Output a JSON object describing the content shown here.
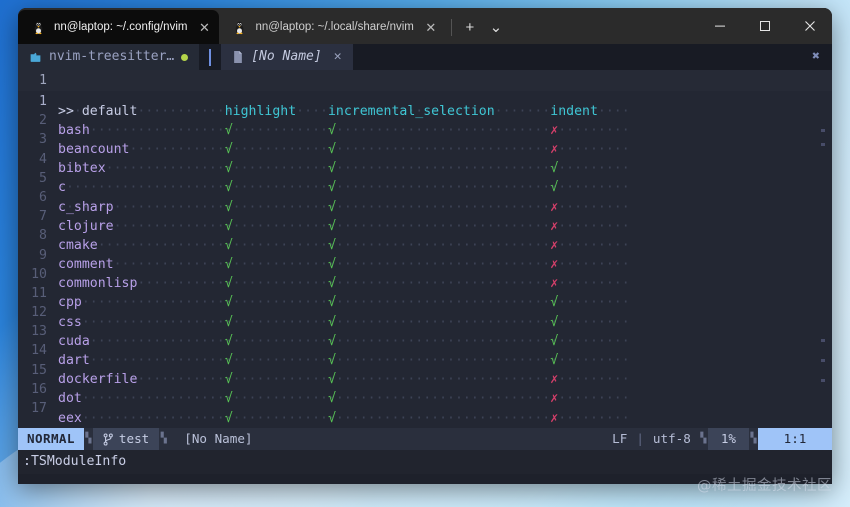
{
  "window": {
    "terminal_tabs": [
      {
        "title": "nn@laptop: ~/.config/nvim",
        "active": true,
        "close_label": "✕",
        "icon": "linux-tux-icon"
      },
      {
        "title": "nn@laptop: ~/.local/share/nvim",
        "active": false,
        "close_label": "✕",
        "icon": "linux-tux-icon"
      }
    ],
    "new_tab_label": "+",
    "tab_menu_label": "⌄",
    "controls": {
      "minimize": "–",
      "maximize": "▢",
      "close": "✕"
    }
  },
  "bufferline": {
    "directory": {
      "name": "nvim-treesitter…",
      "icon": "folder-session-icon",
      "modified_dot": true
    },
    "buffer": {
      "name": "[No Name]",
      "icon": "file-icon",
      "close_label": "✕"
    },
    "close_all_label": "✖"
  },
  "split_top": {
    "line_number": "1"
  },
  "buffer_view": {
    "header": {
      "line_number": "1",
      "marker": ">>",
      "label": "default",
      "columns": [
        "highlight",
        "incremental_selection",
        "indent"
      ]
    },
    "check_yes": "√",
    "check_no": "✗",
    "rows": [
      {
        "line_number": "2",
        "language": "bash",
        "highlight": true,
        "incremental_selection": true,
        "indent": false
      },
      {
        "line_number": "3",
        "language": "beancount",
        "highlight": true,
        "incremental_selection": true,
        "indent": false
      },
      {
        "line_number": "4",
        "language": "bibtex",
        "highlight": true,
        "incremental_selection": true,
        "indent": true
      },
      {
        "line_number": "5",
        "language": "c",
        "highlight": true,
        "incremental_selection": true,
        "indent": true
      },
      {
        "line_number": "6",
        "language": "c_sharp",
        "highlight": true,
        "incremental_selection": true,
        "indent": false
      },
      {
        "line_number": "7",
        "language": "clojure",
        "highlight": true,
        "incremental_selection": true,
        "indent": false
      },
      {
        "line_number": "8",
        "language": "cmake",
        "highlight": true,
        "incremental_selection": true,
        "indent": false
      },
      {
        "line_number": "9",
        "language": "comment",
        "highlight": true,
        "incremental_selection": true,
        "indent": false
      },
      {
        "line_number": "10",
        "language": "commonlisp",
        "highlight": true,
        "incremental_selection": true,
        "indent": false
      },
      {
        "line_number": "11",
        "language": "cpp",
        "highlight": true,
        "incremental_selection": true,
        "indent": true
      },
      {
        "line_number": "12",
        "language": "css",
        "highlight": true,
        "incremental_selection": true,
        "indent": true
      },
      {
        "line_number": "13",
        "language": "cuda",
        "highlight": true,
        "incremental_selection": true,
        "indent": true
      },
      {
        "line_number": "14",
        "language": "dart",
        "highlight": true,
        "incremental_selection": true,
        "indent": true
      },
      {
        "line_number": "15",
        "language": "dockerfile",
        "highlight": true,
        "incremental_selection": true,
        "indent": false
      },
      {
        "line_number": "16",
        "language": "dot",
        "highlight": true,
        "incremental_selection": true,
        "indent": false
      },
      {
        "line_number": "17",
        "language": "eex",
        "highlight": true,
        "incremental_selection": true,
        "indent": false
      }
    ]
  },
  "statusline": {
    "mode": "NORMAL",
    "branch": "test",
    "branch_icon": "git-branch-icon",
    "file": "[No Name]",
    "line_ending": "LF",
    "separator": "|",
    "encoding": "utf-8",
    "percent": "1%",
    "position": "1:1"
  },
  "cmdline": {
    "text": ":TSModuleInfo"
  },
  "watermark": {
    "text": "@稀土掘金技术社区"
  },
  "colors": {
    "accent": "#9fc4f8",
    "yes": "#58c155",
    "no": "#d43f6a",
    "column_header": "#3fc6d4",
    "language": "#b8a0e8",
    "background": "#232733"
  }
}
